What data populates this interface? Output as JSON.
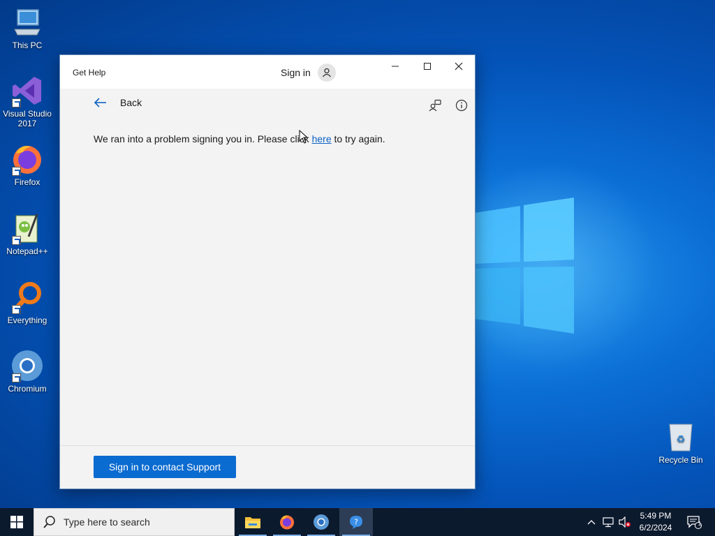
{
  "desktop": {
    "icons": [
      {
        "label": "This PC",
        "icon": "computer-icon"
      },
      {
        "label": "Visual Studio 2017",
        "icon": "visual-studio-icon"
      },
      {
        "label": "Firefox",
        "icon": "firefox-icon"
      },
      {
        "label": "Notepad++",
        "icon": "notepadpp-icon"
      },
      {
        "label": "Everything",
        "icon": "everything-search-icon"
      },
      {
        "label": "Chromium",
        "icon": "chromium-icon"
      }
    ],
    "recycle_bin": {
      "label": "Recycle Bin",
      "icon": "recycle-bin-icon"
    }
  },
  "window": {
    "title": "Get Help",
    "sign_in_label": "Sign in",
    "back_label": "Back",
    "message_before": "We ran into a problem signing you in. Please click ",
    "message_link": "here",
    "message_after": " to try again.",
    "support_button": "Sign in to contact Support",
    "accent_color": "#0a6bd0"
  },
  "taskbar": {
    "search_placeholder": "Type here to search",
    "pinned": [
      "file-explorer-icon",
      "firefox-icon",
      "chromium-icon",
      "get-help-icon"
    ],
    "active_app": "get-help-icon",
    "time": "5:49 PM",
    "date": "6/2/2024",
    "notification_count": "1"
  }
}
